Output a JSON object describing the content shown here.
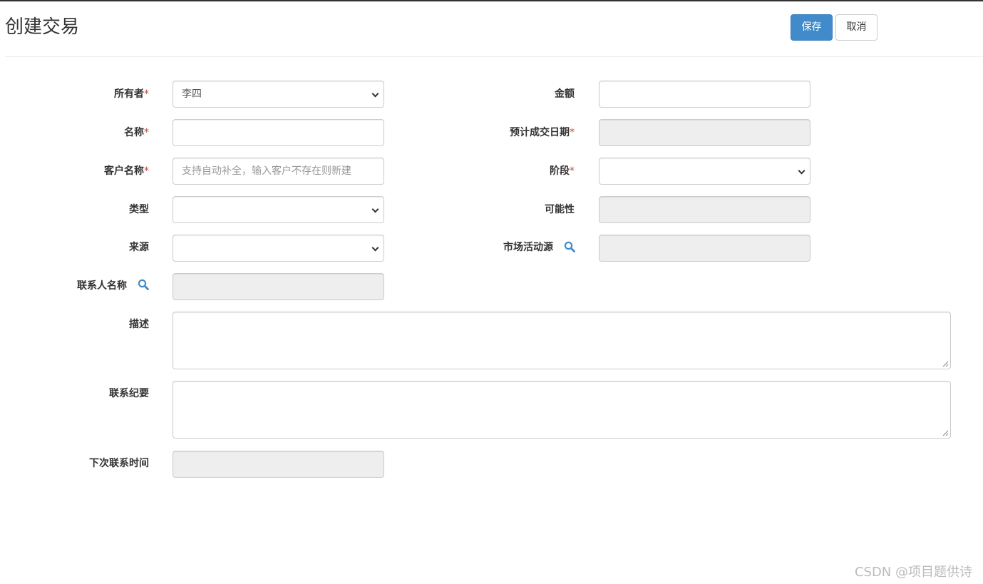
{
  "page": {
    "title": "创建交易"
  },
  "toolbar": {
    "save_label": "保存",
    "cancel_label": "取消"
  },
  "form": {
    "owner": {
      "label": "所有者",
      "required": "*",
      "value": "李四"
    },
    "amount": {
      "label": "金额",
      "value": ""
    },
    "name": {
      "label": "名称",
      "required": "*",
      "value": ""
    },
    "expected_close_date": {
      "label": "预计成交日期",
      "required": "*",
      "value": ""
    },
    "customer_name": {
      "label": "客户名称",
      "required": "*",
      "placeholder": "支持自动补全，输入客户不存在则新建"
    },
    "stage": {
      "label": "阶段",
      "required": "*",
      "value": ""
    },
    "type": {
      "label": "类型",
      "value": ""
    },
    "probability": {
      "label": "可能性",
      "value": ""
    },
    "source": {
      "label": "来源",
      "value": ""
    },
    "campaign_source": {
      "label": "市场活动源",
      "value": ""
    },
    "contact_name": {
      "label": "联系人名称",
      "value": ""
    },
    "description": {
      "label": "描述",
      "value": ""
    },
    "contact_summary": {
      "label": "联系纪要",
      "value": ""
    },
    "next_contact_time": {
      "label": "下次联系时间",
      "value": ""
    }
  },
  "icons": {
    "search": "search-icon",
    "dropdown": "chevron-down-icon"
  },
  "colors": {
    "primary": "#428bca",
    "required": "#b94a48",
    "icon": "#428bca"
  },
  "watermark": "CSDN @项目题供诗"
}
